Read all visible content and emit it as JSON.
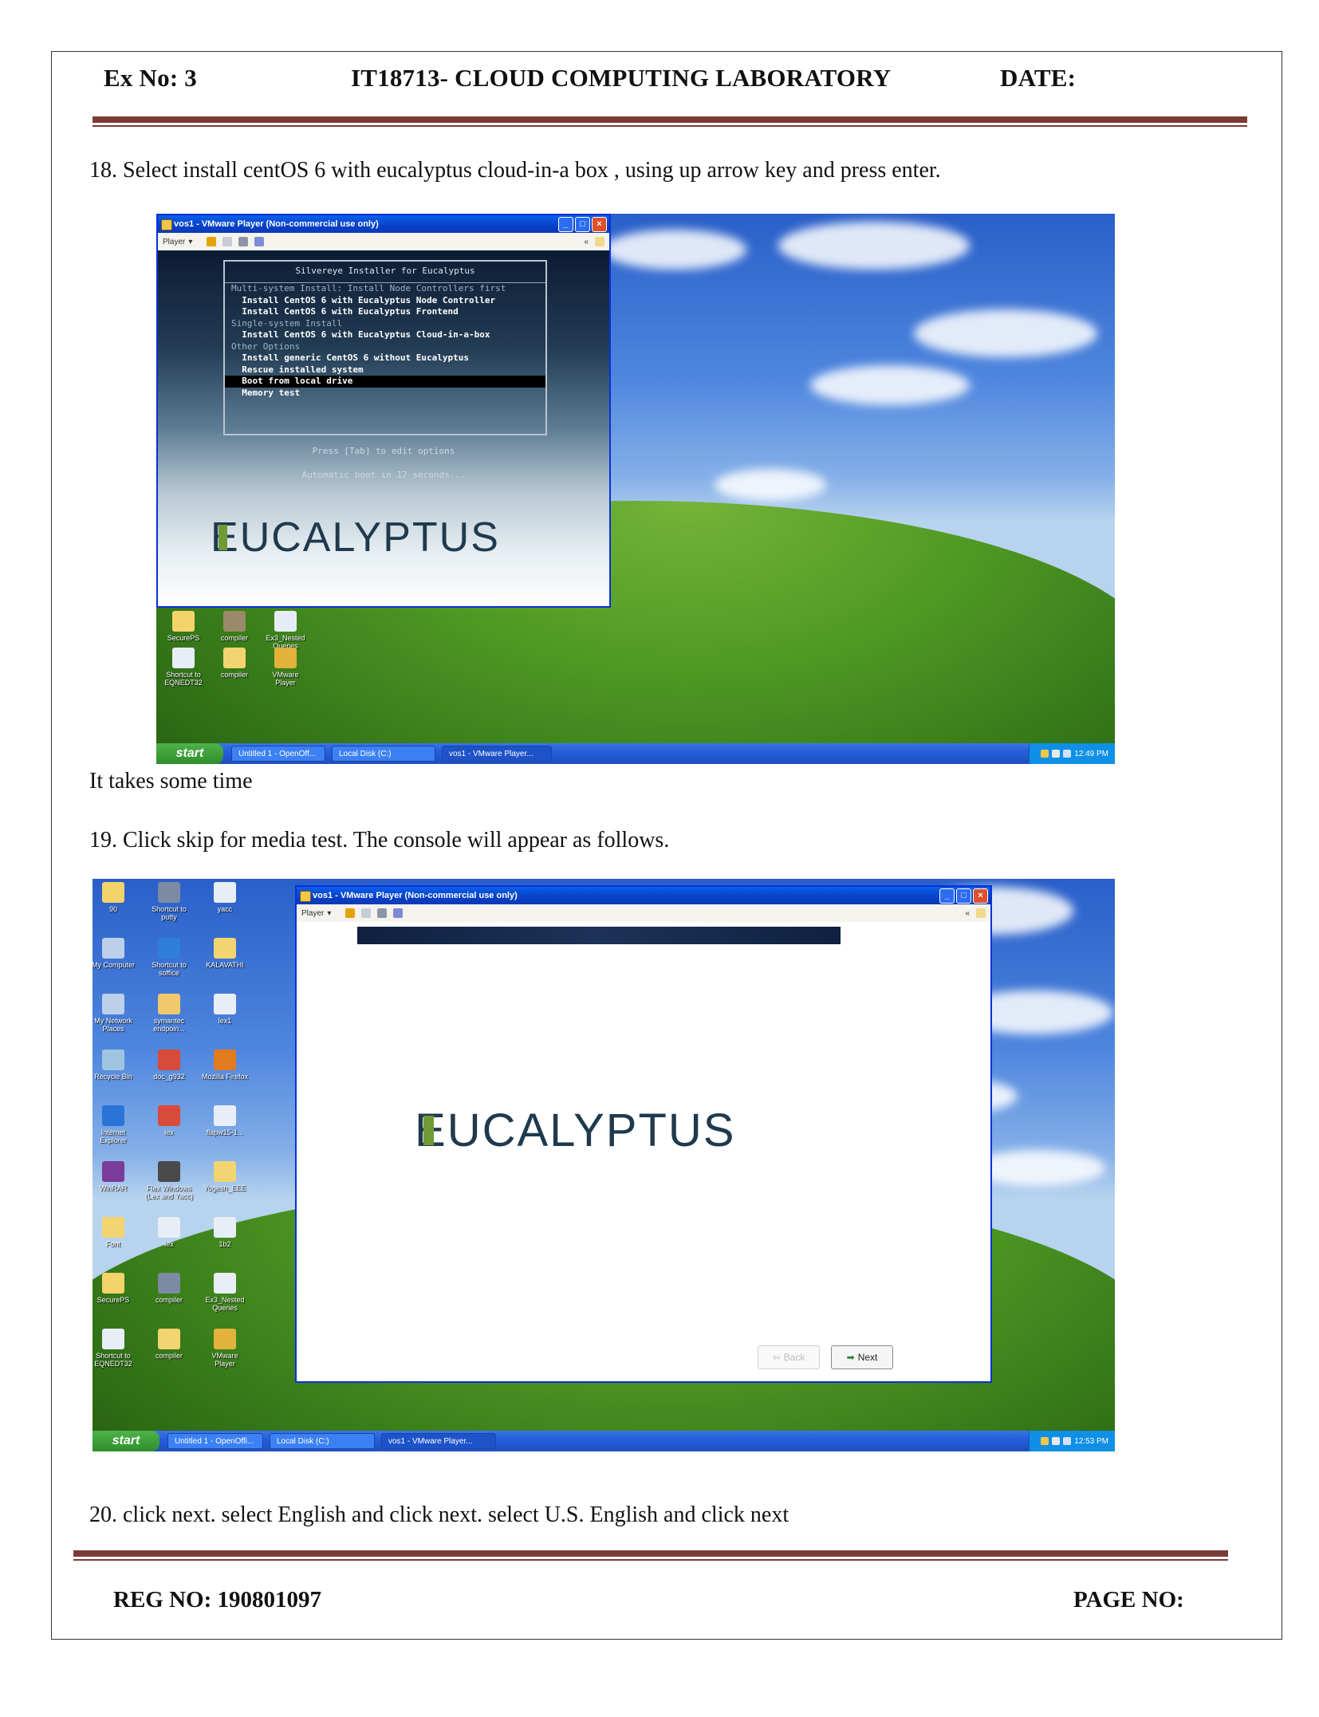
{
  "header": {
    "ex_no": "Ex No: 3",
    "course": "IT18713- CLOUD COMPUTING LABORATORY",
    "date": "DATE:"
  },
  "steps": {
    "step18": "18. Select install centOS 6 with eucalyptus cloud-in-a box , using up arrow key and press enter.",
    "note": "It takes some time",
    "step19": "19. Click skip for media test. The console will appear as follows.",
    "step20": "20. click next. select English and click next. select U.S. English and click next"
  },
  "footer": {
    "reg_no": "REG NO: 190801097",
    "page_no": "PAGE NO:"
  },
  "screenshot1": {
    "window_title": "vos1 - VMware Player (Non-commercial use only)",
    "player_menu": "Player",
    "installer_title": "Silvereye Installer for Eucalyptus",
    "menu_lines": [
      {
        "text": "Multi-system Install: Install Node Controllers first",
        "kind": "cat"
      },
      {
        "text": "  Install CentOS 6 with Eucalyptus Node Controller",
        "kind": "opt"
      },
      {
        "text": "  Install CentOS 6 with Eucalyptus Frontend",
        "kind": "opt"
      },
      {
        "text": "Single-system Install",
        "kind": "cat"
      },
      {
        "text": "  Install CentOS 6 with Eucalyptus Cloud-in-a-box",
        "kind": "opt"
      },
      {
        "text": "Other Options",
        "kind": "cat"
      },
      {
        "text": "  Install generic CentOS 6 without Eucalyptus",
        "kind": "opt"
      },
      {
        "text": "  Rescue installed system",
        "kind": "opt"
      },
      {
        "text": "  Boot from local drive",
        "kind": "sel"
      },
      {
        "text": "  Memory test",
        "kind": "opt"
      }
    ],
    "press_tab": "Press [Tab] to edit options",
    "auto_boot": "Automatic boot in 17 seconds...",
    "logo": "EUCALYPTUS",
    "desktop_icons": [
      "SecurePS",
      "compiler",
      "Ex3_Nested Queries",
      "Shortcut to EQNEDT32",
      "compiler",
      "VMware Player"
    ],
    "start_label": "start",
    "tasks": [
      "Untitled 1 - OpenOff...",
      "Local Disk (C:)",
      "vos1 - VMware Player..."
    ],
    "clock": "12:49 PM"
  },
  "screenshot2": {
    "window_title": "vos1 - VMware Player (Non-commercial use only)",
    "player_menu": "Player",
    "logo": "EUCALYPTUS",
    "back_label": "Back",
    "next_label": "Next",
    "desktop_icons": [
      "90",
      "Shortcut to putty",
      "yacc",
      "My Computer",
      "Shortcut to soffice",
      "KALAVATHI",
      "My Network Places",
      "symantec endpoin...",
      "lex1",
      "Recycle Bin",
      "doc_g932",
      "Mozilla Firefox",
      "Internet Explorer",
      "lex",
      "flapw15-1...",
      "WinRAR",
      "Flex Windows (Lex and Yacc)",
      "Yogesh_EEE",
      "Font",
      "lex",
      "1b2",
      "SecurePS",
      "compiler",
      "Ex3_Nested Queries",
      "Shortcut to EQNEDT32",
      "compiler",
      "VMware Player"
    ],
    "start_label": "start",
    "tasks": [
      "Untitled 1 - OpenOffi...",
      "Local Disk (C:)",
      "vos1 - VMware Player..."
    ],
    "clock": "12:53 PM"
  },
  "colors": {
    "rule": "#7a3b36",
    "xp_blue": "#245edb",
    "eucalyptus_green": "#6f9a35"
  }
}
